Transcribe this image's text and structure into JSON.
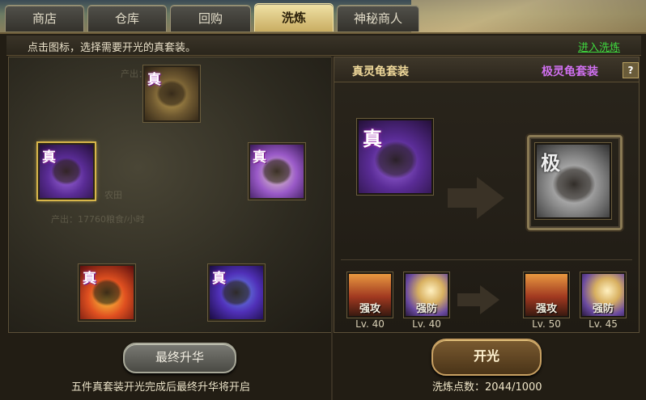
{
  "tabs": [
    {
      "label": "商店",
      "active": false
    },
    {
      "label": "仓库",
      "active": false
    },
    {
      "label": "回购",
      "active": false
    },
    {
      "label": "洗炼",
      "active": true
    },
    {
      "label": "神秘商人",
      "active": false
    }
  ],
  "info": {
    "hint": "点击图标，选择需要开光的真套装。",
    "enter_link": "进入洗炼"
  },
  "left": {
    "slot_tag": "真",
    "ghost_top": "产出：   /小时",
    "ghost_field": "农田",
    "ghost_prod": "产出：17760粮食/小时",
    "final_button": "最终升华",
    "footnote": "五件真套装开光完成后最终升华将开启"
  },
  "right": {
    "title_left": "真灵龟套装",
    "title_right": "极灵龟套装",
    "help": "?",
    "tag_true": "真",
    "tag_ultimate": "极",
    "skills_before": [
      {
        "label": "强攻",
        "level": "Lv. 40",
        "icon": "attack-icon"
      },
      {
        "label": "强防",
        "level": "Lv. 40",
        "icon": "defense-icon"
      }
    ],
    "skills_after": [
      {
        "label": "强攻",
        "level": "Lv. 50",
        "icon": "attack-icon"
      },
      {
        "label": "强防",
        "level": "Lv. 45",
        "icon": "defense-icon"
      }
    ],
    "open_button": "开光",
    "points_label": "洗炼点数：",
    "points_value": "2044/1000"
  }
}
